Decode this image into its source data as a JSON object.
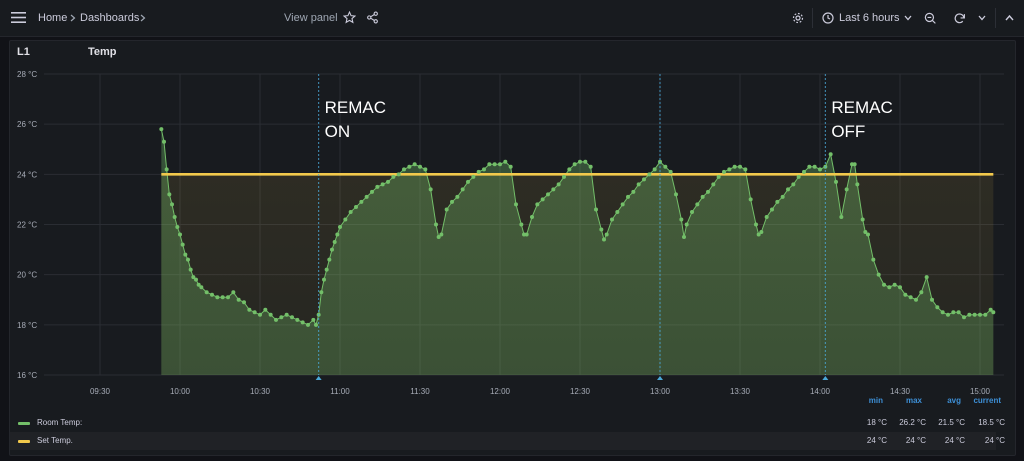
{
  "topbar": {
    "breadcrumb_home": "Home",
    "breadcrumb_dashboards": "Dashboards",
    "view_panel": "View panel",
    "time_range": "Last 6 hours"
  },
  "panel": {
    "left_title": "L1",
    "title": "Temp"
  },
  "colors": {
    "room": "#73bf69",
    "set": "#f2c94c",
    "annotation": "#4aa8d8",
    "legend_header": "#3d8fd6"
  },
  "legend": {
    "headers": [
      "min",
      "max",
      "avg",
      "current"
    ],
    "rows": [
      {
        "name": "Room Temp:",
        "min": "18 °C",
        "max": "26.2 °C",
        "avg": "21.5 °C",
        "current": "18.5 °C"
      },
      {
        "name": "Set Temp.",
        "min": "24 °C",
        "max": "24 °C",
        "avg": "24 °C",
        "current": "24 °C"
      }
    ]
  },
  "chart_data": {
    "type": "line",
    "y_unit": "°C",
    "ylim": [
      16,
      28
    ],
    "y_ticks": [
      "16 °C",
      "18 °C",
      "20 °C",
      "22 °C",
      "24 °C",
      "26 °C",
      "28 °C"
    ],
    "x_ticks": [
      "09:30",
      "10:00",
      "10:30",
      "11:00",
      "11:30",
      "12:00",
      "12:30",
      "13:00",
      "13:30",
      "14:00",
      "14:30",
      "15:00"
    ],
    "grid": true,
    "annotations": [
      {
        "time": "10:52",
        "text_lines": [
          "REMAC",
          "ON"
        ]
      },
      {
        "time": "13:00",
        "text_lines": []
      },
      {
        "time": "14:02",
        "text_lines": [
          "REMAC",
          "OFF"
        ]
      }
    ],
    "series": [
      {
        "name": "Room Temp:",
        "points": [
          [
            "09:53",
            25.8
          ],
          [
            "09:54",
            25.3
          ],
          [
            "09:55",
            24.2
          ],
          [
            "09:56",
            23.2
          ],
          [
            "09:57",
            22.8
          ],
          [
            "09:58",
            22.3
          ],
          [
            "09:59",
            21.9
          ],
          [
            "10:00",
            21.6
          ],
          [
            "10:01",
            21.2
          ],
          [
            "10:02",
            20.8
          ],
          [
            "10:03",
            20.6
          ],
          [
            "10:04",
            20.2
          ],
          [
            "10:05",
            19.9
          ],
          [
            "10:06",
            19.8
          ],
          [
            "10:07",
            19.6
          ],
          [
            "10:08",
            19.5
          ],
          [
            "10:10",
            19.3
          ],
          [
            "10:12",
            19.2
          ],
          [
            "10:14",
            19.1
          ],
          [
            "10:16",
            19.1
          ],
          [
            "10:18",
            19.1
          ],
          [
            "10:20",
            19.3
          ],
          [
            "10:22",
            19.0
          ],
          [
            "10:24",
            18.9
          ],
          [
            "10:26",
            18.6
          ],
          [
            "10:28",
            18.5
          ],
          [
            "10:30",
            18.4
          ],
          [
            "10:32",
            18.6
          ],
          [
            "10:34",
            18.4
          ],
          [
            "10:36",
            18.2
          ],
          [
            "10:38",
            18.3
          ],
          [
            "10:40",
            18.4
          ],
          [
            "10:42",
            18.3
          ],
          [
            "10:44",
            18.2
          ],
          [
            "10:46",
            18.1
          ],
          [
            "10:48",
            18.0
          ],
          [
            "10:50",
            18.2
          ],
          [
            "10:51",
            18.0
          ],
          [
            "10:52",
            18.4
          ],
          [
            "10:53",
            19.3
          ],
          [
            "10:54",
            19.8
          ],
          [
            "10:55",
            20.2
          ],
          [
            "10:56",
            20.6
          ],
          [
            "10:57",
            21.0
          ],
          [
            "10:58",
            21.3
          ],
          [
            "10:59",
            21.6
          ],
          [
            "11:00",
            21.9
          ],
          [
            "11:02",
            22.2
          ],
          [
            "11:04",
            22.5
          ],
          [
            "11:06",
            22.7
          ],
          [
            "11:08",
            22.9
          ],
          [
            "11:10",
            23.1
          ],
          [
            "11:12",
            23.3
          ],
          [
            "11:14",
            23.5
          ],
          [
            "11:16",
            23.6
          ],
          [
            "11:18",
            23.7
          ],
          [
            "11:20",
            23.9
          ],
          [
            "11:22",
            24.0
          ],
          [
            "11:24",
            24.2
          ],
          [
            "11:26",
            24.3
          ],
          [
            "11:28",
            24.4
          ],
          [
            "11:30",
            24.3
          ],
          [
            "11:32",
            24.2
          ],
          [
            "11:34",
            23.4
          ],
          [
            "11:36",
            22.0
          ],
          [
            "11:37",
            21.5
          ],
          [
            "11:38",
            21.6
          ],
          [
            "11:40",
            22.6
          ],
          [
            "11:42",
            22.9
          ],
          [
            "11:44",
            23.1
          ],
          [
            "11:46",
            23.4
          ],
          [
            "11:48",
            23.7
          ],
          [
            "11:50",
            23.9
          ],
          [
            "11:52",
            24.1
          ],
          [
            "11:54",
            24.2
          ],
          [
            "11:56",
            24.4
          ],
          [
            "11:58",
            24.4
          ],
          [
            "12:00",
            24.4
          ],
          [
            "12:02",
            24.5
          ],
          [
            "12:04",
            24.3
          ],
          [
            "12:06",
            22.8
          ],
          [
            "12:08",
            22.0
          ],
          [
            "12:09",
            21.6
          ],
          [
            "12:10",
            21.6
          ],
          [
            "12:12",
            22.3
          ],
          [
            "12:14",
            22.8
          ],
          [
            "12:16",
            23.0
          ],
          [
            "12:18",
            23.2
          ],
          [
            "12:20",
            23.4
          ],
          [
            "12:22",
            23.6
          ],
          [
            "12:24",
            23.9
          ],
          [
            "12:26",
            24.2
          ],
          [
            "12:28",
            24.4
          ],
          [
            "12:30",
            24.5
          ],
          [
            "12:32",
            24.5
          ],
          [
            "12:34",
            24.3
          ],
          [
            "12:36",
            22.6
          ],
          [
            "12:38",
            21.8
          ],
          [
            "12:39",
            21.4
          ],
          [
            "12:40",
            21.6
          ],
          [
            "12:42",
            22.2
          ],
          [
            "12:44",
            22.5
          ],
          [
            "12:46",
            22.8
          ],
          [
            "12:48",
            23.1
          ],
          [
            "12:50",
            23.3
          ],
          [
            "12:52",
            23.6
          ],
          [
            "12:54",
            23.8
          ],
          [
            "12:56",
            24.0
          ],
          [
            "12:58",
            24.2
          ],
          [
            "13:00",
            24.5
          ],
          [
            "13:02",
            24.3
          ],
          [
            "13:04",
            24.1
          ],
          [
            "13:06",
            23.2
          ],
          [
            "13:08",
            22.2
          ],
          [
            "13:09",
            21.5
          ],
          [
            "13:10",
            22.0
          ],
          [
            "13:12",
            22.5
          ],
          [
            "13:14",
            22.8
          ],
          [
            "13:16",
            23.1
          ],
          [
            "13:18",
            23.3
          ],
          [
            "13:20",
            23.6
          ],
          [
            "13:22",
            23.9
          ],
          [
            "13:24",
            24.1
          ],
          [
            "13:26",
            24.2
          ],
          [
            "13:28",
            24.3
          ],
          [
            "13:30",
            24.3
          ],
          [
            "13:32",
            24.2
          ],
          [
            "13:34",
            23.0
          ],
          [
            "13:36",
            22.0
          ],
          [
            "13:37",
            21.6
          ],
          [
            "13:38",
            21.7
          ],
          [
            "13:40",
            22.3
          ],
          [
            "13:42",
            22.6
          ],
          [
            "13:44",
            22.9
          ],
          [
            "13:46",
            23.1
          ],
          [
            "13:48",
            23.4
          ],
          [
            "13:50",
            23.6
          ],
          [
            "13:52",
            23.9
          ],
          [
            "13:54",
            24.1
          ],
          [
            "13:56",
            24.3
          ],
          [
            "13:58",
            24.3
          ],
          [
            "14:00",
            24.2
          ],
          [
            "14:02",
            24.3
          ],
          [
            "14:04",
            24.8
          ],
          [
            "14:06",
            23.7
          ],
          [
            "14:08",
            22.3
          ],
          [
            "14:10",
            23.4
          ],
          [
            "14:12",
            24.4
          ],
          [
            "14:13",
            24.4
          ],
          [
            "14:14",
            23.6
          ],
          [
            "14:16",
            22.2
          ],
          [
            "14:17",
            21.7
          ],
          [
            "14:18",
            21.6
          ],
          [
            "14:20",
            20.6
          ],
          [
            "14:22",
            20.0
          ],
          [
            "14:24",
            19.6
          ],
          [
            "14:26",
            19.5
          ],
          [
            "14:28",
            19.6
          ],
          [
            "14:30",
            19.5
          ],
          [
            "14:32",
            19.2
          ],
          [
            "14:34",
            19.1
          ],
          [
            "14:36",
            19.0
          ],
          [
            "14:38",
            19.3
          ],
          [
            "14:40",
            19.9
          ],
          [
            "14:42",
            19.0
          ],
          [
            "14:44",
            18.7
          ],
          [
            "14:46",
            18.5
          ],
          [
            "14:48",
            18.4
          ],
          [
            "14:50",
            18.5
          ],
          [
            "14:52",
            18.5
          ],
          [
            "14:54",
            18.3
          ],
          [
            "14:56",
            18.4
          ],
          [
            "14:58",
            18.4
          ],
          [
            "15:00",
            18.4
          ],
          [
            "15:02",
            18.4
          ],
          [
            "15:04",
            18.6
          ],
          [
            "15:05",
            18.5
          ]
        ]
      },
      {
        "name": "Set Temp.",
        "points": [
          [
            "09:53",
            24.0
          ],
          [
            "15:05",
            24.0
          ]
        ]
      }
    ]
  }
}
